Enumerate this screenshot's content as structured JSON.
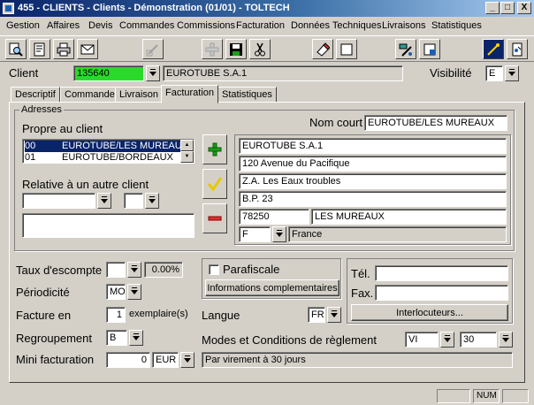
{
  "window": {
    "title": "455 - CLIENTS - Clients - Démonstration (01/01) - TOLTECH",
    "minimize": "_",
    "restore": "□",
    "close": "X"
  },
  "menu": [
    "Gestion",
    "Affaires",
    "Devis",
    "Commandes",
    "Commissions",
    "Facturation",
    "Données Techniques",
    "Livraisons",
    "Statistiques"
  ],
  "toolbar": {
    "icons": [
      "search-icon",
      "preview-icon",
      "print-icon",
      "mail-icon",
      "edit-disabled-icon",
      "add-disabled-icon",
      "save-icon",
      "cut-icon",
      "eraser-icon",
      "new-page-icon",
      "tools-icon",
      "help-icon"
    ]
  },
  "header": {
    "client_label": "Client",
    "client_code": "135640",
    "client_name": "EUROTUBE S.A.1",
    "visibility_label": "Visibilité",
    "visibility_value": "E"
  },
  "tabs": [
    "Descriptif",
    "Commande",
    "Livraison",
    "Facturation",
    "Statistiques"
  ],
  "active_tab": "Facturation",
  "addresses": {
    "group_title": "Adresses",
    "own_client_label": "Propre au client",
    "short_name_label": "Nom court",
    "short_name_value": "EUROTUBE/LES MUREAUX",
    "list": [
      {
        "code": "00",
        "name": "EUROTUBE/LES MUREAUX",
        "selected": true
      },
      {
        "code": "01",
        "name": "EUROTUBE/BORDEAUX",
        "selected": false
      }
    ],
    "other_client_label": "Relative à un autre client",
    "address_lines": [
      "EUROTUBE S.A.1",
      "120 Avenue du Pacifique",
      "Z.A. Les Eaux troubles",
      "B.P. 23"
    ],
    "postal_code": "78250",
    "city": "LES MUREAUX",
    "country_code": "F",
    "country_name": "France"
  },
  "billing": {
    "discount_label": "Taux d'escompte",
    "discount_value": "0.00%",
    "periodicity_label": "Périodicité",
    "periodicity_value": "MO",
    "invoice_label": "Facture en",
    "invoice_copies": "1",
    "invoice_unit": "exemplaire(s)",
    "grouping_label": "Regroupement",
    "grouping_value": "B",
    "min_invoice_label": "Mini facturation",
    "min_invoice_value": "0",
    "min_invoice_currency": "EUR"
  },
  "extra": {
    "parafiscal_label": "Parafiscale",
    "complementary_button": "Informations complementaires",
    "language_label": "Langue",
    "language_value": "FR",
    "payment_label": "Modes et Conditions de règlement",
    "payment_mode": "VI",
    "payment_days": "30",
    "payment_description": "Par virement à 30 jours"
  },
  "contact": {
    "phone_label": "Tél.",
    "fax_label": "Fax.",
    "contacts_button": "Interlocuteurs..."
  },
  "status": {
    "num": "NUM"
  },
  "colors": {
    "title_bar": "#0a246a",
    "client_code_bg": "#2bd92b",
    "selection": "#0a246a"
  }
}
